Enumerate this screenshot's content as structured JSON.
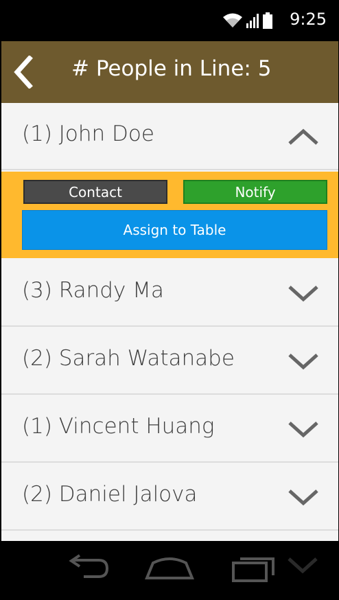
{
  "status_bar": {
    "time": "9:25"
  },
  "header": {
    "title": "# People in Line: 5"
  },
  "queue": [
    {
      "label": "(1) John Doe",
      "expanded": true
    },
    {
      "label": "(3) Randy Ma",
      "expanded": false
    },
    {
      "label": "(2) Sarah Watanabe",
      "expanded": false
    },
    {
      "label": "(1) Vincent Huang",
      "expanded": false
    },
    {
      "label": "(2) Daniel Jalova",
      "expanded": false
    }
  ],
  "actions": {
    "contact": "Contact",
    "notify": "Notify",
    "assign": "Assign to Table"
  },
  "icons": {
    "back": "chevron-left-icon",
    "collapse": "chevron-up-icon",
    "expand": "chevron-down-icon",
    "wifi": "wifi-icon",
    "signal": "signal-icon",
    "battery": "battery-icon",
    "nav_back": "back-arrow-icon",
    "nav_home": "home-icon",
    "nav_recents": "recents-icon"
  },
  "colors": {
    "header": "#6e5a2e",
    "panel": "#ffb92e",
    "contact": "#4a4a4a",
    "notify": "#2ea12c",
    "assign": "#0a93e8"
  }
}
